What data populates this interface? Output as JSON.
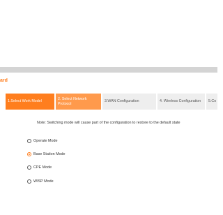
{
  "wizard": {
    "title": "ard"
  },
  "steps": [
    {
      "label": "1.Select Work Model",
      "state": "done"
    },
    {
      "label": "2. Select Network Protocol",
      "state": "active"
    },
    {
      "label": "3.WAN Configuration",
      "state": "todo"
    },
    {
      "label": "4. Wireless Configuration",
      "state": "todo"
    },
    {
      "label": "5.Co",
      "state": "todo"
    }
  ],
  "note": "Note: Switching mode will cause part of the configuration to restore to the default state",
  "modes": [
    {
      "label": "Operate Mode",
      "selected": false
    },
    {
      "label": "Base Station Mode",
      "selected": true
    },
    {
      "label": "CPE Mode",
      "selected": false
    },
    {
      "label": "WISP Mode",
      "selected": false
    }
  ],
  "colors": {
    "accent": "#ff7e1e",
    "accent_light": "#ff9a4c",
    "inactive_step": "#eeeeee",
    "topbar": "#d4d4d4"
  }
}
